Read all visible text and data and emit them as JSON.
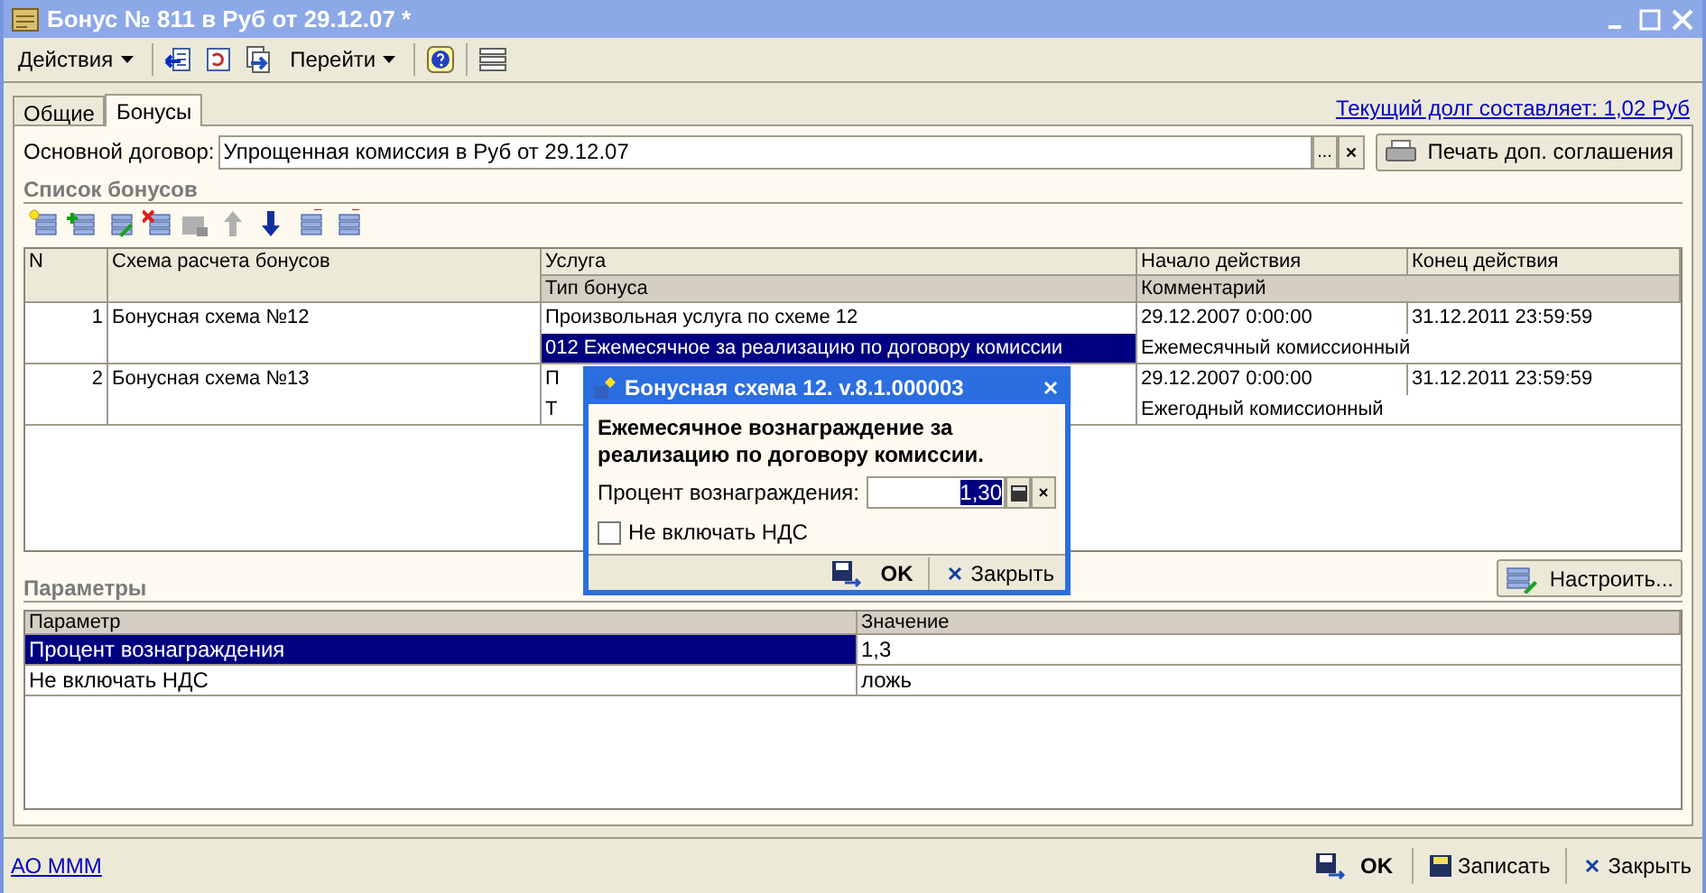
{
  "window": {
    "title": "Бонус № 811 в Руб от 29.12.07 *"
  },
  "toolbar": {
    "actions_menu": "Действия",
    "goto_menu": "Перейти"
  },
  "tabs": [
    {
      "label": "Общие",
      "selected": false
    },
    {
      "label": "Бонусы",
      "selected": true
    }
  ],
  "debt_link": "Текущий долг составляет: 1,02 Руб",
  "contract": {
    "label": "Основной договор:",
    "value": "Упрощенная комиссия в Руб от 29.12.07",
    "select_button": "...",
    "print_button": "Печать доп. соглашения"
  },
  "bonus_list": {
    "title": "Список бонусов",
    "columns": [
      {
        "label": "N"
      },
      {
        "label": "Схема расчета бонусов"
      },
      {
        "label": "Услуга",
        "sub": "Тип бонуса"
      },
      {
        "label": "Начало действия",
        "sub": "Комментарий"
      },
      {
        "label": "Конец действия"
      }
    ],
    "rows": [
      {
        "n": "1",
        "scheme": "Бонусная схема №12",
        "service": "Произвольная услуга по схеме 12",
        "bonus_type": "012 Ежемесячное за реализацию по договору комиссии",
        "bonus_type_selected": true,
        "start": "29.12.2007 0:00:00",
        "end": "31.12.2011 23:59:59",
        "comment": "Ежемесячный комиссионный"
      },
      {
        "n": "2",
        "scheme": "Бонусная схема №13",
        "service": "П",
        "bonus_type": "Т",
        "bonus_type_selected": false,
        "start": "29.12.2007 0:00:00",
        "end": "31.12.2011 23:59:59",
        "comment": "Ежегодный комиссионный"
      }
    ]
  },
  "parameters": {
    "title": "Параметры",
    "setup_button": "Настроить...",
    "columns": [
      "Параметр",
      "Значение"
    ],
    "rows": [
      {
        "name": "Процент вознаграждения",
        "value": "1,3",
        "selected": true
      },
      {
        "name": "Не включать НДС",
        "value": "ложь",
        "selected": false
      }
    ]
  },
  "footer": {
    "org_link": "АО МММ",
    "ok": "OK",
    "save": "Записать",
    "close": "Закрыть"
  },
  "dialog": {
    "title": "Бонусная схема 12. v.8.1.000003",
    "description": "Ежемесячное вознаграждение за реализацию по договору комиссии.",
    "percent_label": "Процент вознаграждения:",
    "percent_value": "1,30",
    "vat_checkbox": {
      "label": "Не включать НДС",
      "checked": false
    },
    "ok": "OK",
    "close": "Закрыть"
  }
}
